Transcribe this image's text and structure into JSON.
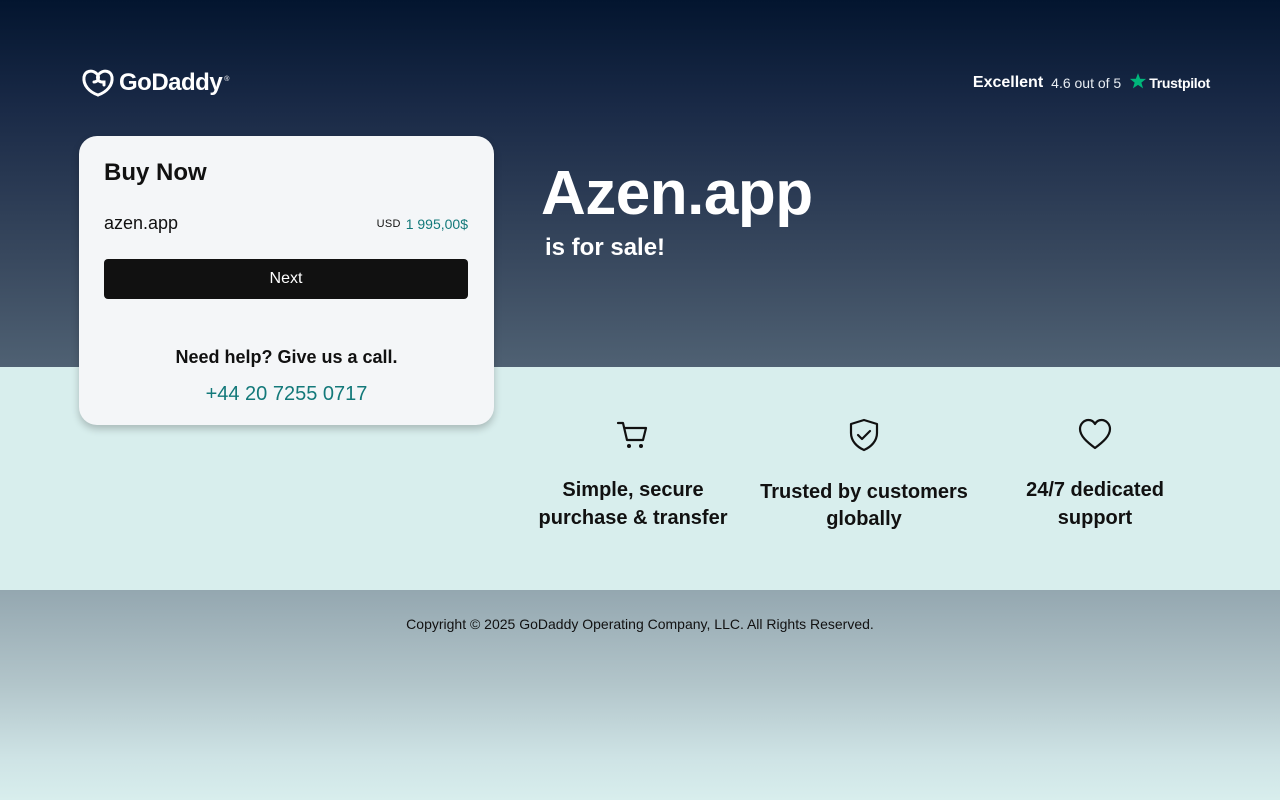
{
  "header": {
    "logo_text": "GoDaddy",
    "logo_icon": "godaddy-logo-icon",
    "trust": {
      "rating_label": "Excellent",
      "score_text": "4.6 out of 5",
      "brand": "Trustpilot",
      "brand_icon": "star-icon",
      "star_color": "#00b67a"
    }
  },
  "buy_card": {
    "title": "Buy Now",
    "domain": "azen.app",
    "currency": "USD",
    "price": "1 995,00$",
    "next_label": "Next",
    "help_text": "Need help? Give us a call.",
    "phone": "+44 20 7255 0717"
  },
  "hero": {
    "domain_title": "Azen.app",
    "subtitle": "is for sale!"
  },
  "features": [
    {
      "icon": "cart-icon",
      "line1": "Simple, secure",
      "line2": "purchase & transfer"
    },
    {
      "icon": "shield-check-icon",
      "line1": "Trusted by customers",
      "line2": "globally"
    },
    {
      "icon": "heart-icon",
      "line1": "24/7 dedicated",
      "line2": "support"
    }
  ],
  "footer": {
    "copyright": "Copyright © 2025 GoDaddy Operating Company, LLC. All Rights Reserved."
  },
  "colors": {
    "accent_teal": "#13797a",
    "button_dark": "#111111",
    "hero_top": "#03152f",
    "band_light": "#d8eeed"
  }
}
